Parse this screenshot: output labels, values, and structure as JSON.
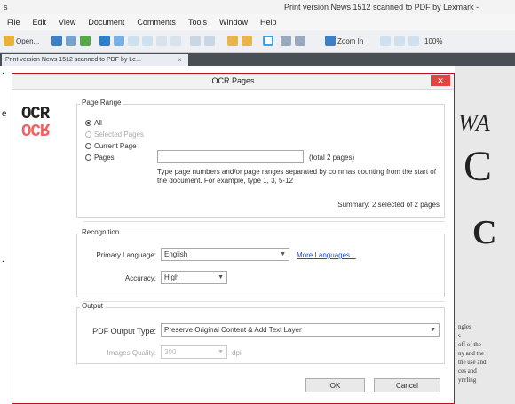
{
  "window": {
    "title": "Print version News 1512 scanned to PDF by Lexmark -",
    "left_title": "s"
  },
  "menu": [
    "File",
    "Edit",
    "View",
    "Document",
    "Comments",
    "Tools",
    "Window",
    "Help"
  ],
  "toolbar": {
    "open_label": "Open...",
    "zoom_label": "Zoom In",
    "zoom_pct": "100%"
  },
  "tab": {
    "label": "Print version News 1512 scanned to PDF by Le...",
    "close": "×"
  },
  "doc_left_chars": [
    ".",
    "e",
    "."
  ],
  "doc_right": {
    "big": [
      "WA",
      "C",
      "C"
    ],
    "small": [
      "ngles",
      "s",
      "off of the",
      "ny and the",
      "the use and",
      "ces and",
      "ynrling"
    ]
  },
  "dialog": {
    "title": "OCR Pages",
    "close": "✕",
    "logo_top": "OCR",
    "logo_bottom": "OCR",
    "page_range": {
      "label": "Page Range",
      "all": "All",
      "selected": "Selected Pages",
      "current": "Current Page",
      "pages": "Pages",
      "pages_value": "",
      "total": "(total 2 pages)",
      "note": "Type page numbers and/or page ranges separated by commas counting from the start of the document. For example, type 1, 3, 5-12",
      "summary": "Summary: 2 selected of 2 pages"
    },
    "recognition": {
      "label": "Recognition",
      "language_label": "Primary Language:",
      "language": "English",
      "more_languages": "More Languages...",
      "accuracy_label": "Accuracy:",
      "accuracy": "High"
    },
    "output": {
      "label": "Output",
      "type_label": "PDF Output Type:",
      "type": "Preserve Original Content & Add Text Layer",
      "quality_label": "Images Quality:",
      "quality": "300",
      "quality_unit": "dpi"
    },
    "ok": "OK",
    "cancel": "Cancel"
  }
}
